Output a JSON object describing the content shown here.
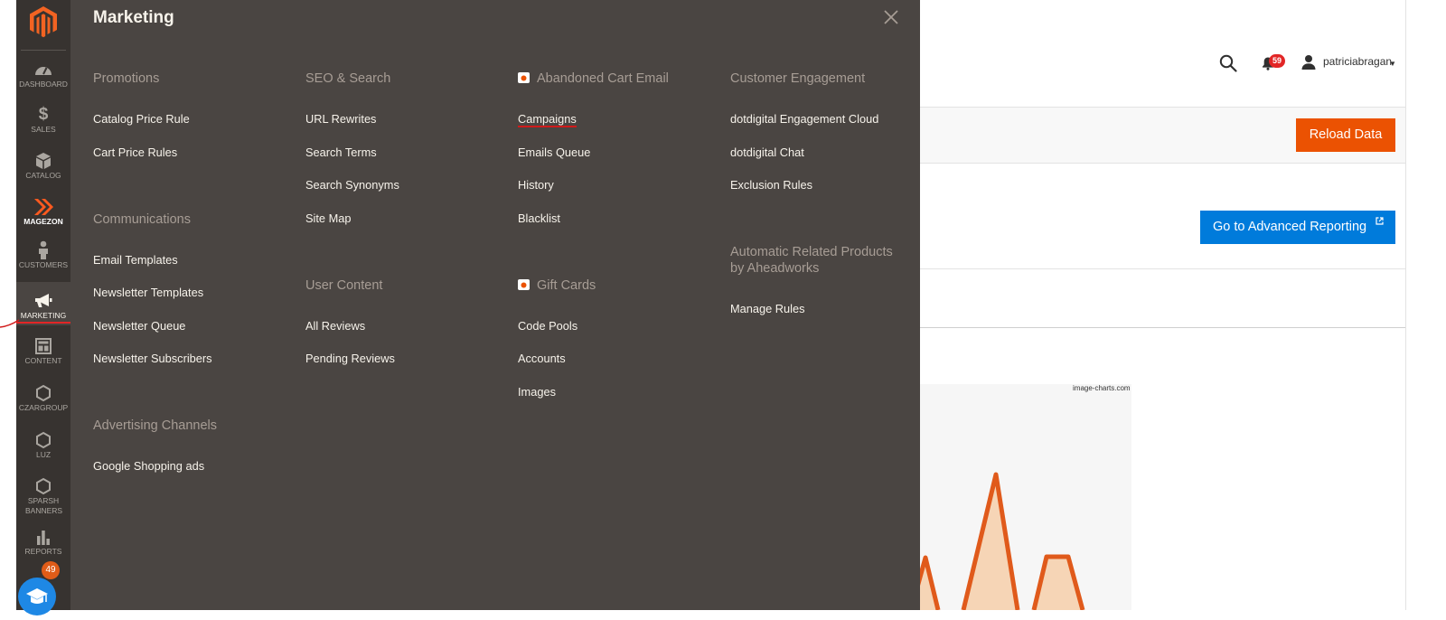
{
  "sidebar": {
    "items": [
      {
        "label": "DASHBOARD",
        "icon": "dashboard-icon"
      },
      {
        "label": "SALES",
        "icon": "dollar-icon"
      },
      {
        "label": "CATALOG",
        "icon": "cube-icon"
      },
      {
        "label": "MAGEZON",
        "icon": "magezon-logo-icon"
      },
      {
        "label": "CUSTOMERS",
        "icon": "person-icon"
      },
      {
        "label": "MARKETING",
        "icon": "megaphone-icon"
      },
      {
        "label": "CONTENT",
        "icon": "layout-icon"
      },
      {
        "label": "CZARGROUP",
        "icon": "hexagon-icon"
      },
      {
        "label": "LUZ",
        "icon": "hexagon-icon"
      },
      {
        "label": "SPARSH BANNERS",
        "icon": "hexagon-icon"
      },
      {
        "label": "REPORTS",
        "icon": "bar-chart-icon"
      }
    ],
    "help_badge": "49"
  },
  "header": {
    "notifications_count": "59",
    "username": "patriciabragan"
  },
  "page": {
    "reload_label": "Reload Data",
    "advanced_reporting_label": "Go to Advanced Reporting",
    "chart_credit": "image-charts.com"
  },
  "panel": {
    "title": "Marketing",
    "columns": [
      {
        "sections": [
          {
            "title": "Promotions",
            "links": [
              "Catalog Price Rule",
              "Cart Price Rules"
            ]
          },
          {
            "title": "Communications",
            "links": [
              "Email Templates",
              "Newsletter Templates",
              "Newsletter Queue",
              "Newsletter Subscribers"
            ]
          },
          {
            "title": "Advertising Channels",
            "links": [
              "Google Shopping ads"
            ]
          }
        ]
      },
      {
        "sections": [
          {
            "title": "SEO & Search",
            "links": [
              "URL Rewrites",
              "Search Terms",
              "Search Synonyms",
              "Site Map"
            ]
          },
          {
            "title": "User Content",
            "links": [
              "All Reviews",
              "Pending Reviews"
            ]
          }
        ]
      },
      {
        "sections": [
          {
            "title": "Abandoned Cart Email",
            "links": [
              "Campaigns",
              "Emails Queue",
              "History",
              "Blacklist"
            ]
          },
          {
            "title": "Gift Cards",
            "links": [
              "Code Pools",
              "Accounts",
              "Images"
            ]
          }
        ]
      },
      {
        "sections": [
          {
            "title": "Customer Engagement",
            "links": [
              "dotdigital Engagement Cloud",
              "dotdigital Chat",
              "Exclusion Rules"
            ]
          },
          {
            "title_line1": "Automatic Related Products",
            "title_line2": "by Aheadworks",
            "links": [
              "Manage Rules"
            ]
          }
        ]
      }
    ]
  },
  "colors": {
    "sidebar_bg": "#373330",
    "panel_bg": "#4a4542",
    "accent_orange": "#eb5202",
    "accent_blue": "#007bdb",
    "badge_red": "#e22626"
  }
}
